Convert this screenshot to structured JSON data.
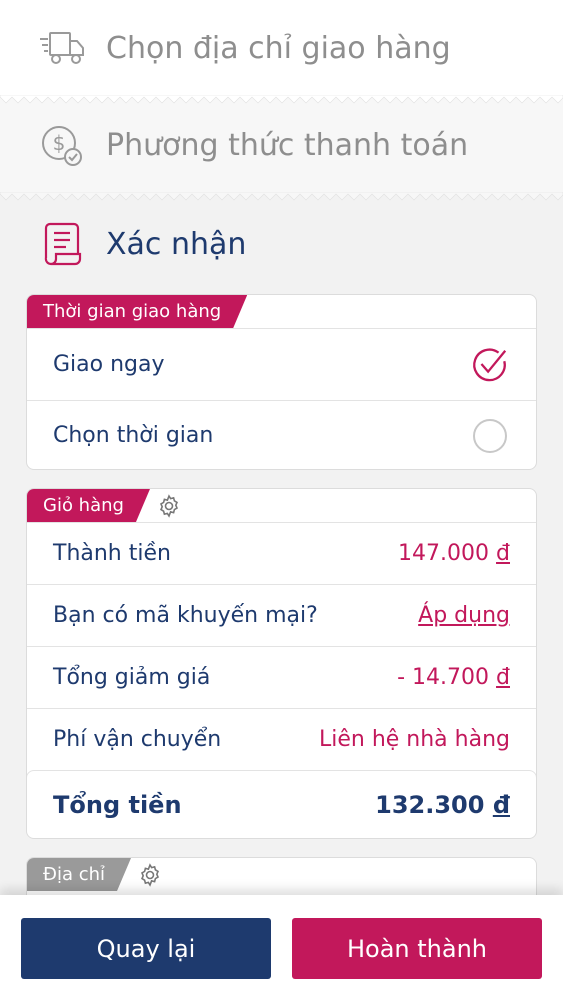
{
  "steps": {
    "delivery_address": "Chọn địa chỉ giao hàng",
    "payment_method": "Phương thức thanh toán",
    "confirm": "Xác nhận"
  },
  "delivery_time": {
    "tag": "Thời gian giao hàng",
    "options": [
      {
        "label": "Giao ngay",
        "selected": true
      },
      {
        "label": "Chọn thời gian",
        "selected": false
      }
    ]
  },
  "cart": {
    "tag": "Giỏ hàng",
    "subtotal_label": "Thành tiền",
    "subtotal_amount": "147.000",
    "promo_label": "Bạn có mã khuyến mại?",
    "promo_apply": "Áp dụng",
    "discount_label": "Tổng giảm giá",
    "discount_amount": "- 14.700",
    "shipping_label": "Phí vận chuyển",
    "shipping_value": "Liên hệ nhà hàng",
    "total_label": "Tổng tiền",
    "total_amount": "132.300",
    "currency": "đ"
  },
  "address": {
    "tag": "Địa chỉ"
  },
  "buttons": {
    "back": "Quay lại",
    "done": "Hoàn thành"
  },
  "colors": {
    "primary_navy": "#1e3a6e",
    "accent_crimson": "#c2185b",
    "muted_grey": "#8e8e8e"
  }
}
